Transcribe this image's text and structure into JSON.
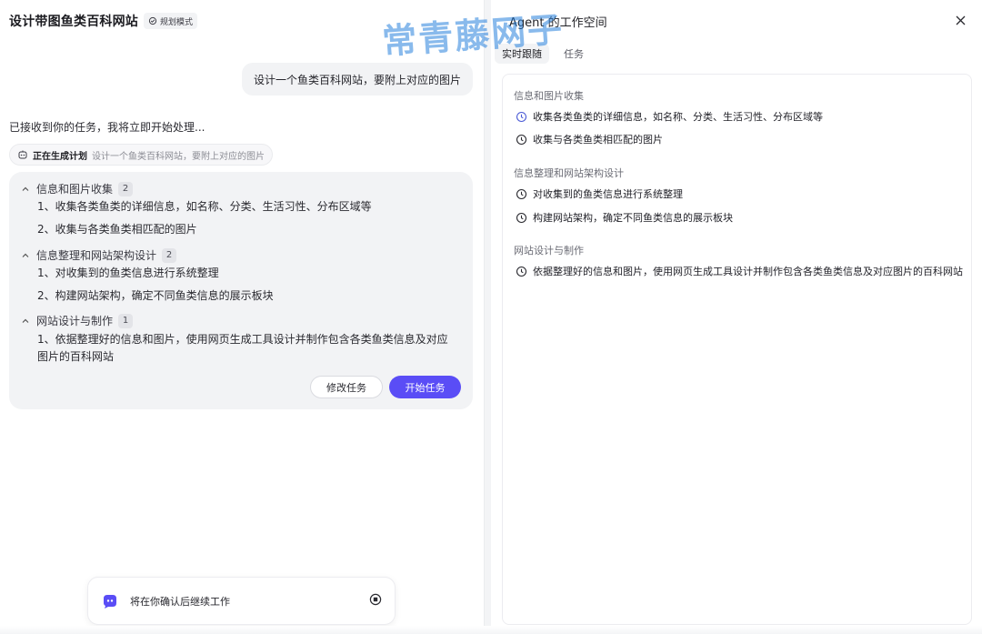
{
  "conversation": {
    "title": "设计带图鱼类百科网站",
    "mode_badge": "规划模式",
    "user_message": "设计一个鱼类百科网站，要附上对应的图片",
    "assistant_ack": "已接收到你的任务，我将立即开始处理...",
    "generating": {
      "status": "正在生成计划",
      "task": "设计一个鱼类百科网站，要附上对应的图片"
    }
  },
  "plan": {
    "groups": [
      {
        "title": "信息和图片收集",
        "count": "2",
        "steps": [
          "1、收集各类鱼类的详细信息，如名称、分类、生活习性、分布区域等",
          "2、收集与各类鱼类相匹配的图片"
        ]
      },
      {
        "title": "信息整理和网站架构设计",
        "count": "2",
        "steps": [
          "1、对收集到的鱼类信息进行系统整理",
          "2、构建网站架构，确定不同鱼类信息的展示板块"
        ]
      },
      {
        "title": "网站设计与制作",
        "count": "1",
        "steps": [
          "1、依据整理好的信息和图片，使用网页生成工具设计并制作包含各类鱼类信息及对应图片的百科网站"
        ]
      }
    ],
    "edit_label": "修改任务",
    "start_label": "开始任务"
  },
  "confirm_bar": {
    "text": "将在你确认后继续工作"
  },
  "workspace": {
    "title": "Agent 的工作空间",
    "tabs": [
      "实时跟随",
      "任务"
    ],
    "sections": [
      {
        "title": "信息和图片收集",
        "tasks": [
          "收集各类鱼类的详细信息，如名称、分类、生活习性、分布区域等",
          "收集与各类鱼类相匹配的图片"
        ]
      },
      {
        "title": "信息整理和网站架构设计",
        "tasks": [
          "对收集到的鱼类信息进行系统整理",
          "构建网站架构，确定不同鱼类信息的展示板块"
        ]
      },
      {
        "title": "网站设计与制作",
        "tasks": [
          "依据整理好的信息和图片，使用网页生成工具设计并制作包含各类鱼类信息及对应图片的百科网站"
        ]
      }
    ]
  },
  "watermark": "常青藤网子",
  "colors": {
    "accent": "#5a4df6",
    "card_bg": "#f2f3f5",
    "active_clock": "#4b5bd6"
  }
}
